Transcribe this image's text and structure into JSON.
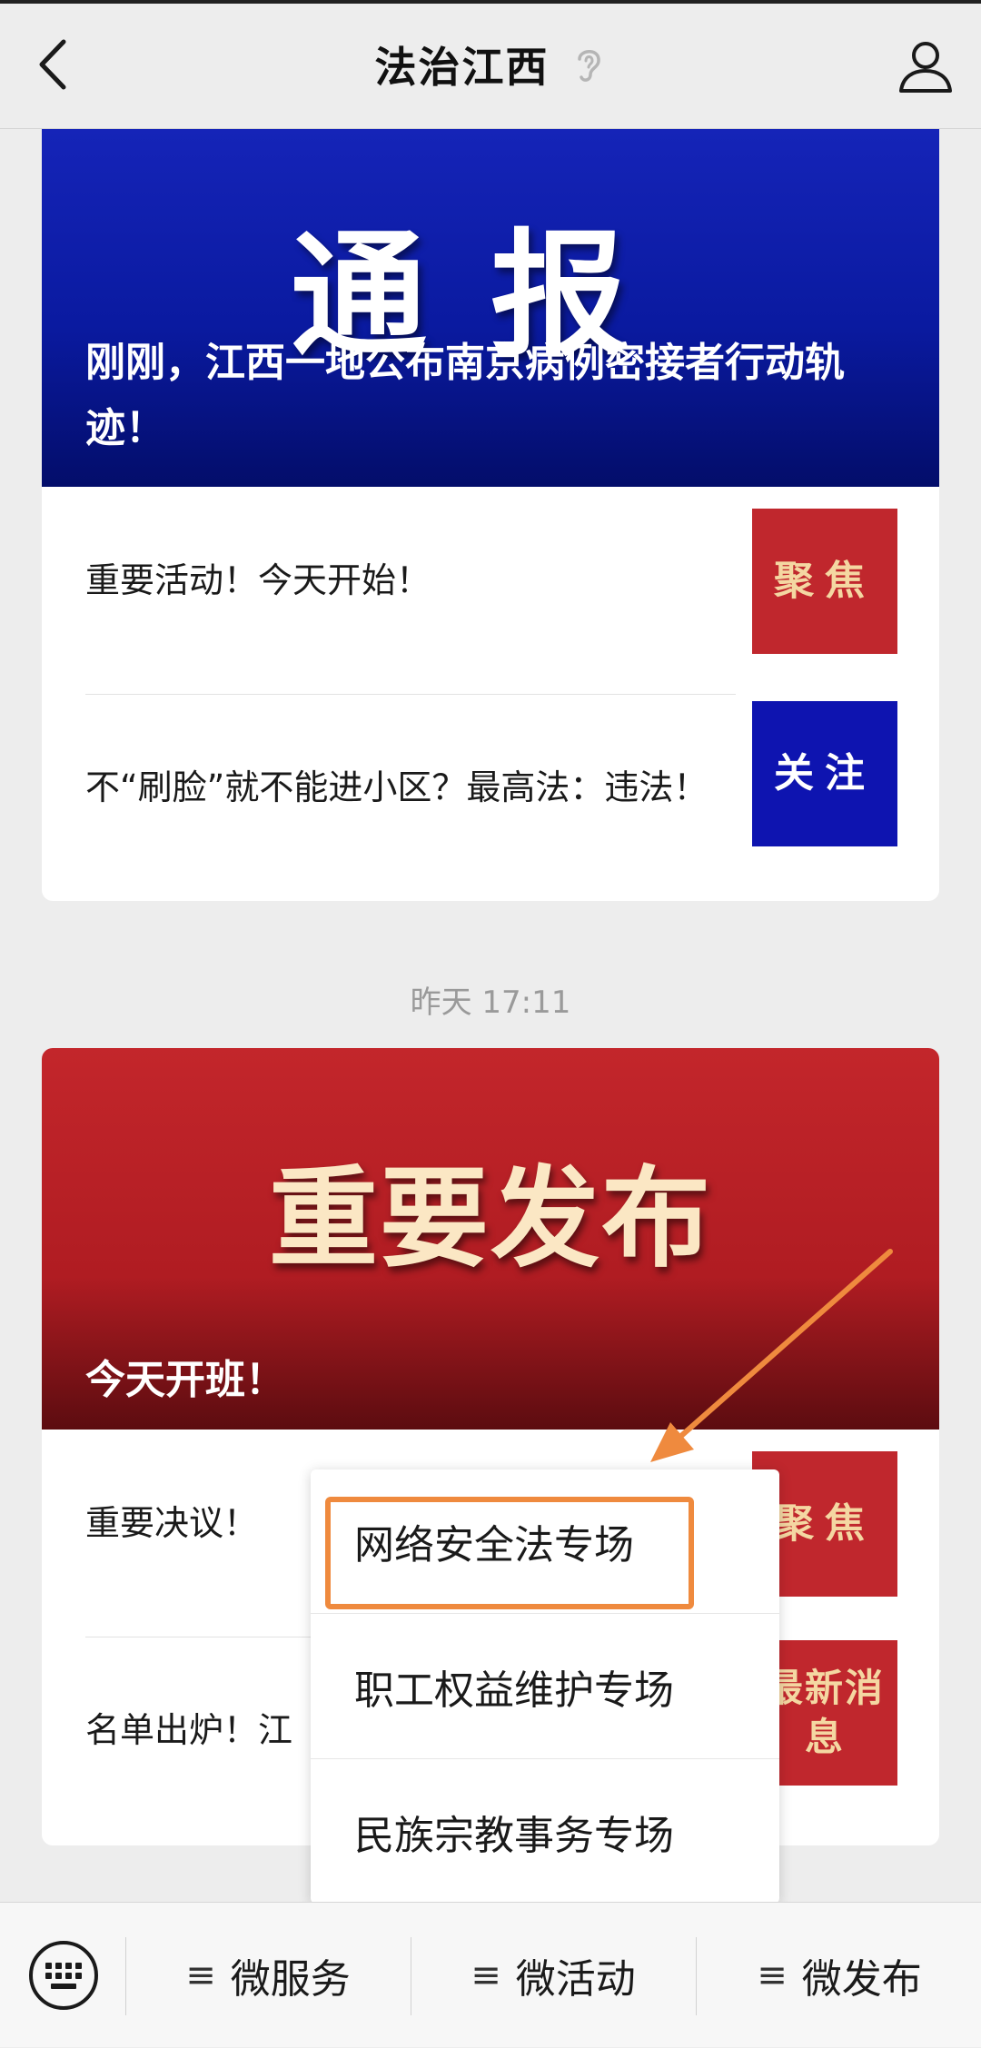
{
  "header": {
    "title": "法治江西",
    "back_icon": "chevron-left-icon",
    "ear_icon": "ear-icon",
    "profile_icon": "user-icon"
  },
  "articles": [
    {
      "banner_title": "通报",
      "headline": "刚刚，江西一地公布南京病例密接者行动轨迹！",
      "items": [
        {
          "text": "重要活动！今天开始！",
          "thumb": "聚焦"
        },
        {
          "text": "不“刷脸”就不能进小区？最高法：违法！",
          "thumb": "关注"
        }
      ]
    },
    {
      "banner_title": "重要发布",
      "headline": "今天开班！",
      "items": [
        {
          "text": "重要决议！",
          "thumb": "聚焦"
        },
        {
          "text": "名单出炉！江",
          "thumb": "最新消息"
        }
      ]
    }
  ],
  "timestamp": "昨天 17:11",
  "popup_menu": {
    "items": [
      "网络安全法专场",
      "职工权益维护专场",
      "民族宗教事务专场"
    ]
  },
  "bottom_menu": {
    "keyboard_icon": "keyboard-icon",
    "items": [
      {
        "glyph": "≡",
        "label": "微服务"
      },
      {
        "glyph": "≡",
        "label": "微活动"
      },
      {
        "glyph": "≡",
        "label": "微发布"
      }
    ]
  },
  "colors": {
    "accent_orange": "#ef8a3e",
    "banner_blue": "#0a1aa0",
    "banner_red": "#b01c22",
    "thumb_red": "#c0272d",
    "thumb_blue": "#0e14b0"
  }
}
